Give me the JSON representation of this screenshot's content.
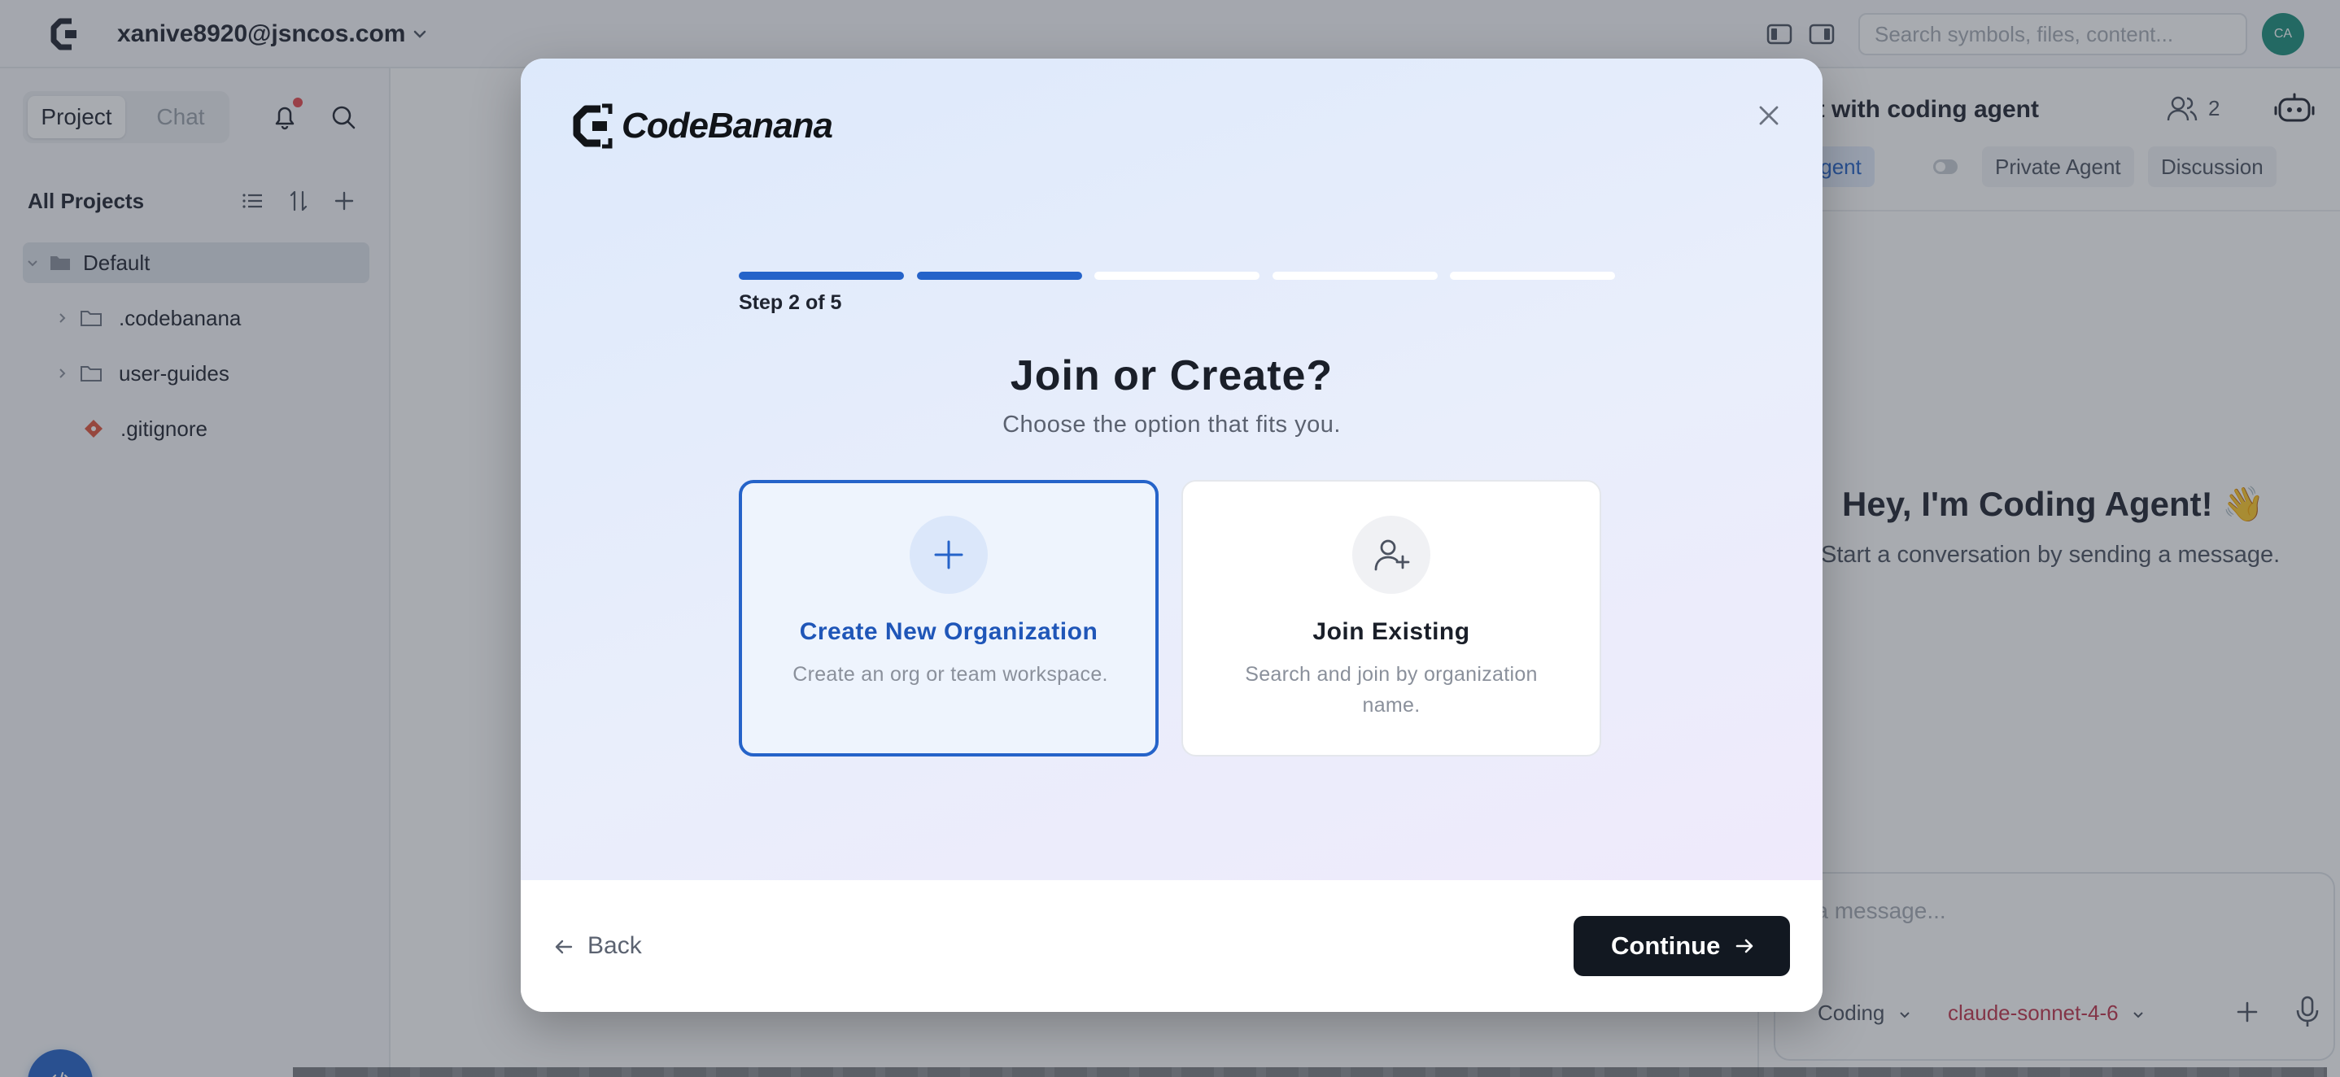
{
  "header": {
    "account_email": "xanive8920@jsncos.com",
    "search_placeholder": "Search symbols, files, content...",
    "avatar_initials": "CA"
  },
  "sidebar": {
    "tabs": [
      {
        "label": "Project",
        "active": true
      },
      {
        "label": "Chat",
        "active": false
      }
    ],
    "notification_dot": true,
    "section_title": "All Projects",
    "tree": [
      {
        "label": "Default",
        "type": "folder",
        "expanded": true,
        "selected": true,
        "depth": 0
      },
      {
        "label": ".codebanana",
        "type": "folder",
        "expanded": false,
        "depth": 1
      },
      {
        "label": "user-guides",
        "type": "folder",
        "expanded": false,
        "depth": 1
      },
      {
        "label": ".gitignore",
        "type": "git-file",
        "depth": 1
      }
    ]
  },
  "right_panel": {
    "title": "at with coding agent",
    "member_count": "2",
    "agent_tabs": [
      "am Agent",
      "Private Agent",
      "Discussion"
    ],
    "greeting": "Hey, I'm Coding Agent! 👋",
    "greeting_sub": "Start a conversation by sending a message.",
    "composer_placeholder": "d a message...",
    "mode": "Coding",
    "model": "claude-sonnet-4-6"
  },
  "modal": {
    "brand": "CodeBanana",
    "progress": {
      "current_step": 2,
      "total_steps": 5
    },
    "step_label": "Step 2 of 5",
    "title": "Join or Create?",
    "subtitle": "Choose the option that fits you.",
    "options": [
      {
        "title": "Create New Organization",
        "description": "Create an org or team workspace.",
        "icon": "plus-icon",
        "selected": true
      },
      {
        "title": "Join Existing",
        "description": "Search and join by organization name.",
        "icon": "user-plus-icon",
        "selected": false
      }
    ],
    "back_label": "Back",
    "continue_label": "Continue"
  },
  "colors": {
    "accent": "#2563c9",
    "primary_button": "#121821",
    "avatar": "#1b8e7a",
    "model_text": "#c0334a"
  }
}
